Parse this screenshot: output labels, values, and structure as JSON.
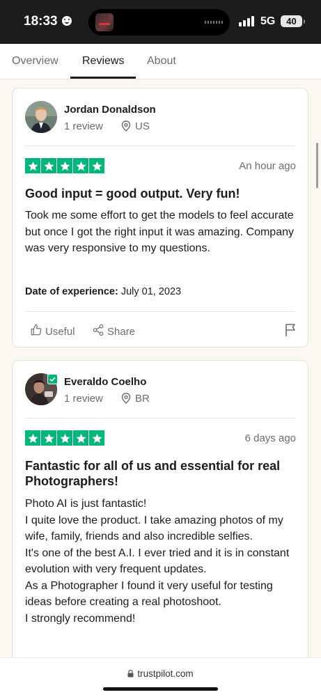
{
  "status_bar": {
    "time": "18:33",
    "network": "5G",
    "battery": "40"
  },
  "tabs": [
    {
      "label": "Overview"
    },
    {
      "label": "Reviews"
    },
    {
      "label": "About"
    }
  ],
  "reviews": [
    {
      "name": "Jordan Donaldson",
      "review_count": "1 review",
      "country": "US",
      "rating": 5,
      "date": "An hour ago",
      "title": "Good input = good output. Very fun!",
      "body": "Took me some effort to get the models to feel accurate but once I got the right input it was amazing. Company was very responsive to my questions.",
      "experience_label": "Date of experience:",
      "experience_date": "July 01, 2023",
      "useful_label": "Useful",
      "share_label": "Share"
    },
    {
      "name": "Everaldo Coelho",
      "review_count": "1 review",
      "country": "BR",
      "rating": 5,
      "date": "6 days ago",
      "title": "Fantastic for all of us and essential for real Photographers!",
      "body": "Photo AI is just fantastic!\nI quite love the product. I take amazing photos of my wife, family, friends and also incredible selfies.\nIt's one of the best A.I. I ever tried and it is in constant evolution with very frequent updates.\nAs a Photographer I found it very useful for testing ideas before creating a real photoshoot.\nI strongly recommend!"
    }
  ],
  "browser": {
    "url": "trustpilot.com"
  },
  "colors": {
    "star_green": "#00b67a",
    "background": "#fbf7f1"
  }
}
